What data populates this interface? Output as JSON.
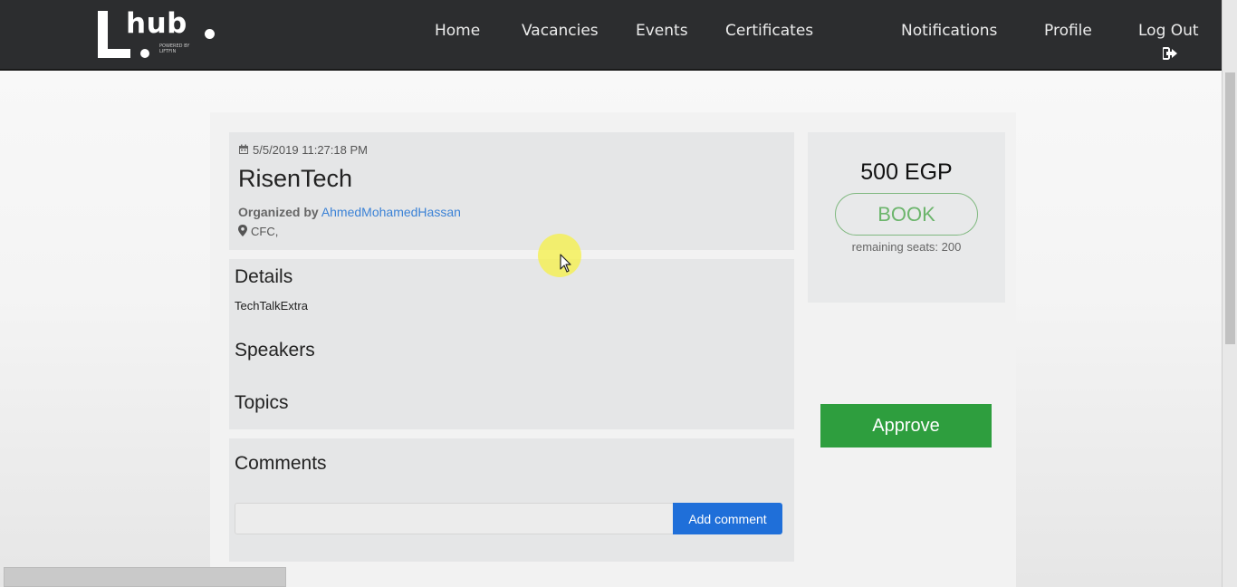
{
  "nav": {
    "logo_text": "hub",
    "logo_subtext": "POWERED BY LIFTFIN",
    "links": [
      "Home",
      "Vacancies",
      "Events",
      "Certificates",
      "Notifications",
      "Profile",
      "Log Out"
    ]
  },
  "event": {
    "datetime": "5/5/2019 11:27:18 PM",
    "title": "RisenTech",
    "organized_by_label": "Organized by",
    "organizer": "AhmedMohamedHassan",
    "location": "CFC,"
  },
  "details": {
    "heading": "Details",
    "body": "TechTalkExtra",
    "speakers_heading": "Speakers",
    "topics_heading": "Topics"
  },
  "comments": {
    "heading": "Comments",
    "input_value": "",
    "add_label": "Add comment"
  },
  "booking": {
    "price": "500 EGP",
    "book_label": "BOOK",
    "remaining_seats": "remaining seats: 200"
  },
  "approve_label": "Approve",
  "colors": {
    "navbar": "#2c2d2f",
    "approve": "#2e9e3e",
    "add_comment": "#1f6fd9",
    "link": "#3b82d6",
    "book_green": "#6cb56c"
  }
}
